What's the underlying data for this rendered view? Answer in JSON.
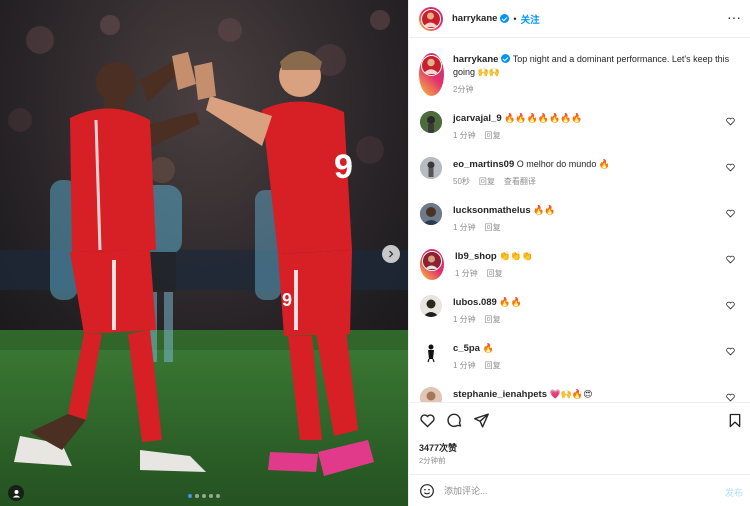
{
  "header": {
    "username": "harrykane",
    "follow_label": "关注",
    "more_icon": "more-dots-icon"
  },
  "caption": {
    "username": "harrykane",
    "text": "Top night and a dominant performance. Let's keep this going 🙌🙌",
    "time": "2分钟"
  },
  "comments": [
    {
      "username": "jcarvajal_9",
      "text": "🔥🔥🔥🔥🔥🔥🔥",
      "time": "1 分钟",
      "reply": "回复",
      "translate": ""
    },
    {
      "username": "eo_martins09",
      "text": "O melhor do mundo 🔥",
      "time": "50秒",
      "reply": "回复",
      "translate": "查看翻译"
    },
    {
      "username": "lucksonmathelus",
      "text": "🔥🔥",
      "time": "1 分钟",
      "reply": "回复",
      "translate": ""
    },
    {
      "username": "lb9_shop",
      "text": "👏👏👏",
      "time": "1 分钟",
      "reply": "回复",
      "translate": ""
    },
    {
      "username": "lubos.089",
      "text": "🔥🔥",
      "time": "1 分钟",
      "reply": "回复",
      "translate": ""
    },
    {
      "username": "c_5pa",
      "text": "🔥",
      "time": "1 分钟",
      "reply": "回复",
      "translate": ""
    },
    {
      "username": "stephanie_ienahpets",
      "text": "💗🙌🔥😍",
      "time": "",
      "reply": "",
      "translate": ""
    }
  ],
  "stats": {
    "likes": "3477次赞",
    "time": "2分钟前"
  },
  "add_comment": {
    "placeholder": "添加评论...",
    "post_label": "发布"
  },
  "carousel": {
    "slides": 5,
    "active": 1
  },
  "colors": {
    "accent": "#0095f6",
    "jersey_red": "#d71f26",
    "pitch": "#2f6a2c"
  }
}
